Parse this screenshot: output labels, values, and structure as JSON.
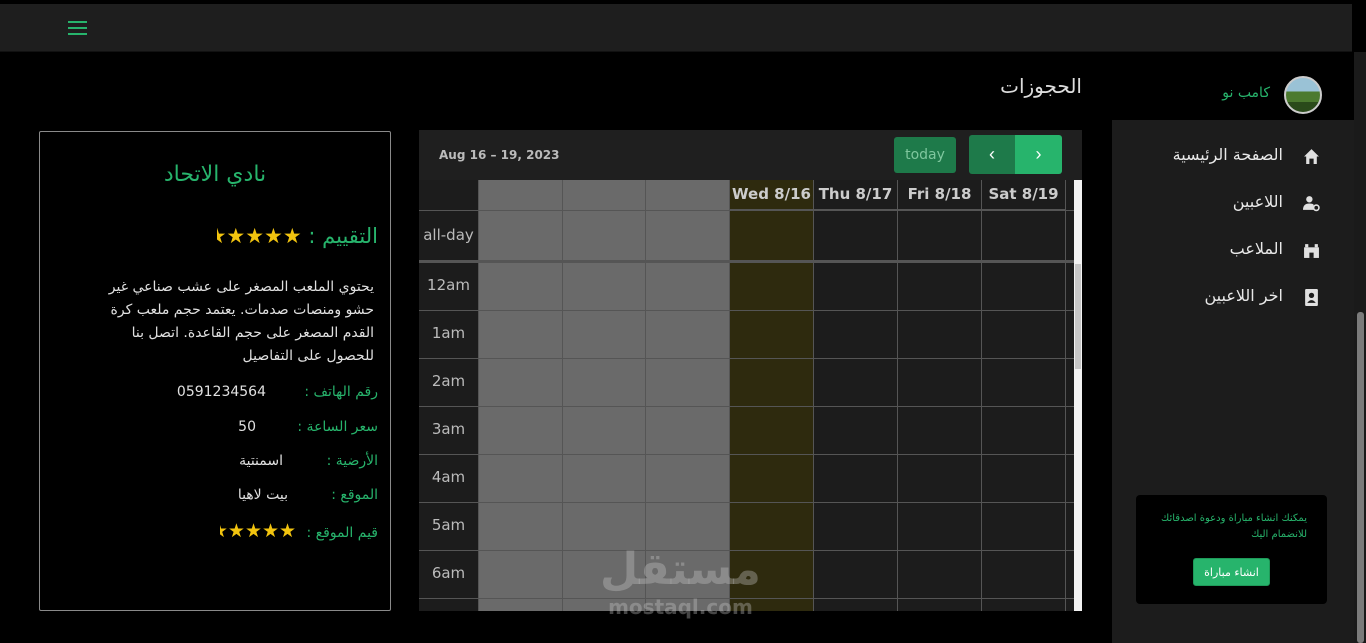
{
  "sidebar": {
    "brand_name": "كامب نو",
    "items": [
      {
        "label": "الصفحة الرئيسية",
        "icon": "home-icon"
      },
      {
        "label": "اللاعبين",
        "icon": "user-gear-icon"
      },
      {
        "label": "الملاعب",
        "icon": "stadium-icon"
      },
      {
        "label": "اخر اللاعبين",
        "icon": "contact-card-icon"
      }
    ],
    "promo_text": "يمكنك انشاء مباراة ودعوة اصدقائك للانضمام اليك",
    "promo_button": "انشاء مباراة"
  },
  "page": {
    "title": "الحجوزات"
  },
  "calendar": {
    "range": "Aug 16 – 19, 2023",
    "today_label": "today",
    "prev_icon": "chevron-left-icon",
    "next_icon": "chevron-right-icon",
    "days": [
      "Wed 8/16",
      "Thu 8/17",
      "Fri 8/18",
      "Sat 8/19"
    ],
    "allday_label": "all-day",
    "times": [
      "12am",
      "1am",
      "2am",
      "3am",
      "4am",
      "5am",
      "6am"
    ]
  },
  "venue": {
    "name": "نادي الاتحاد",
    "rating_label": "التقييم :",
    "rating": 4.5,
    "description": "يحتوي الملعب المصغر على عشب صناعي غير حشو ومنصات صدمات. يعتمد حجم ملعب كرة القدم المصغر على حجم القاعدة. اتصل بنا للحصول على التفاصيل",
    "phone_label": "رقم الهاتف :",
    "phone": "0591234564",
    "hour_price_label": "سعر الساعة :",
    "hour_price": "50",
    "floor_label": "الأرضية :",
    "floor": "اسمنتية",
    "location_label": "الموقع :",
    "location": "بيت لاهيا",
    "rate_location_label": "قيم الموقع :",
    "rate_location": 4.5
  },
  "watermark": {
    "arabic": "مستقل",
    "latin": "mostaql.com"
  },
  "colors": {
    "accent": "#27b46c",
    "star": "#f2c40f",
    "today_highlight": "#2e2a0e"
  }
}
